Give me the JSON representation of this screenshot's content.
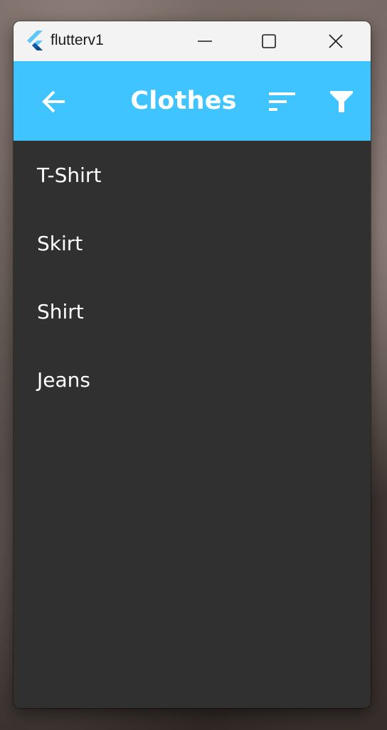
{
  "window": {
    "title": "flutterv1",
    "controls": [
      "minimize-icon",
      "maximize-icon",
      "close-icon"
    ]
  },
  "appbar": {
    "title": "Clothes",
    "color": "#40c4ff",
    "actions": [
      "back-arrow-icon",
      "sort-icon",
      "filter-icon"
    ]
  },
  "list": {
    "items": [
      {
        "label": "T-Shirt"
      },
      {
        "label": "Skirt"
      },
      {
        "label": "Shirt"
      },
      {
        "label": "Jeans"
      }
    ]
  },
  "colors": {
    "background": "#303030",
    "titlebar": "#f3f3f3",
    "text": "#ffffff"
  }
}
